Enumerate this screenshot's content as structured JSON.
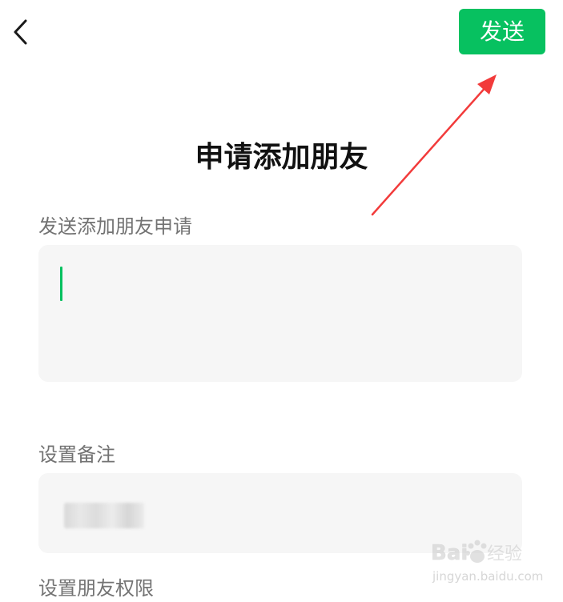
{
  "header": {
    "back_icon": "chevron-left-icon",
    "send_label": "发送",
    "accent_color": "#07c160"
  },
  "page": {
    "title": "申请添加朋友"
  },
  "request_section": {
    "label": "发送添加朋友申请",
    "value": ""
  },
  "remark_section": {
    "label": "设置备注"
  },
  "permission_section": {
    "label": "设置朋友权限"
  },
  "annotation": {
    "arrow_color": "#f23b3b"
  },
  "watermark": {
    "brand": "Baidu经验",
    "url": "jingyan.baidu.com"
  }
}
